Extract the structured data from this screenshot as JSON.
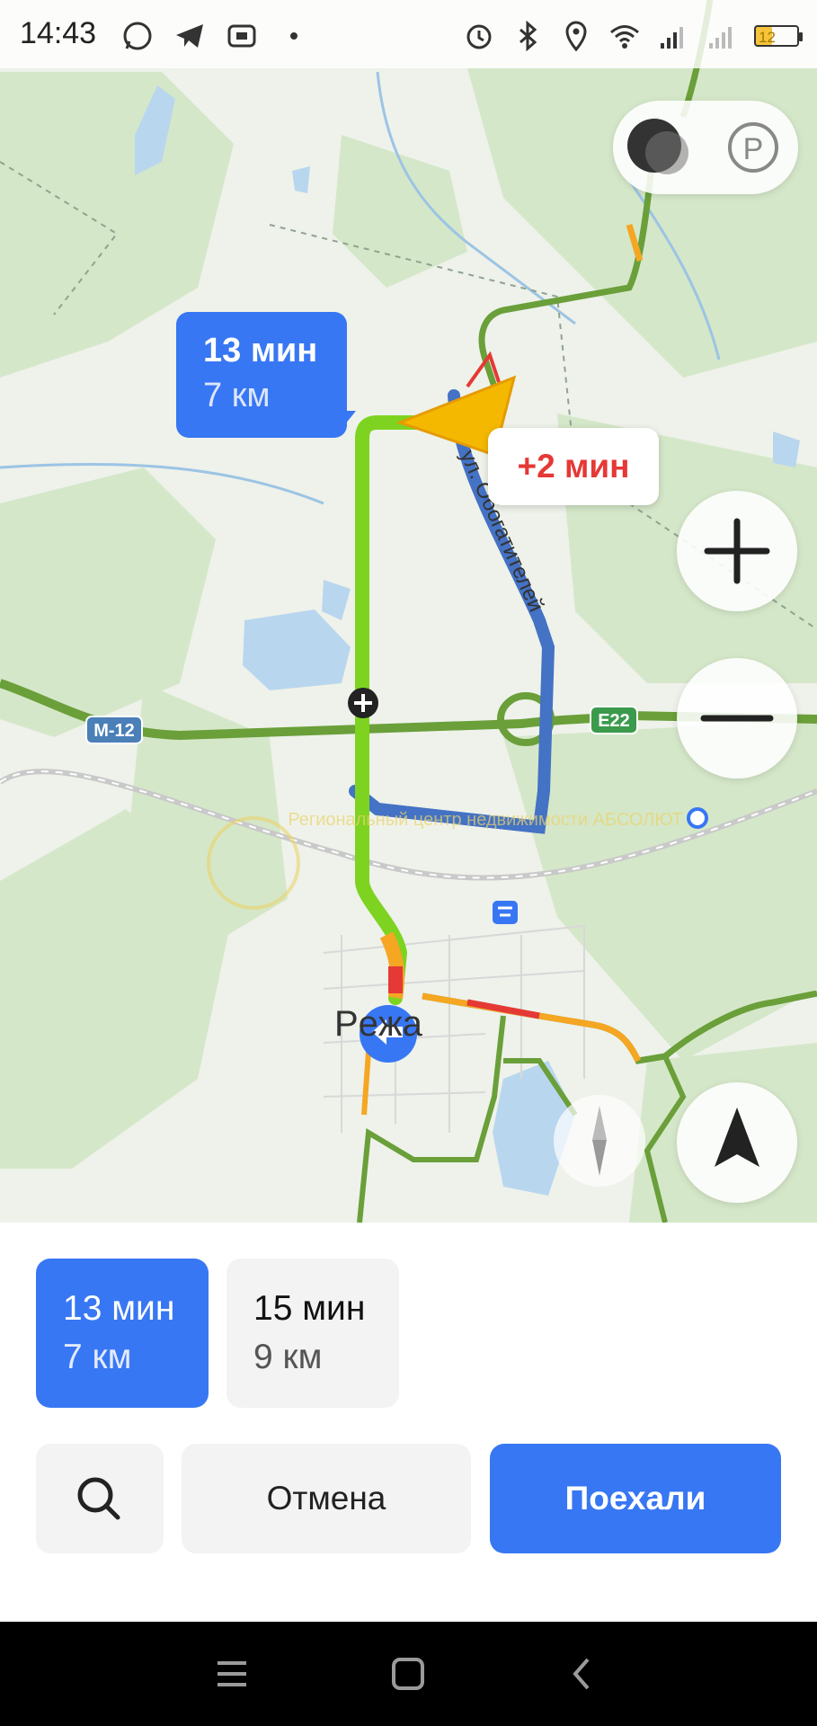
{
  "status_bar": {
    "time": "14:43",
    "left_icons": [
      "whatsapp-icon",
      "telegram-icon",
      "cast-icon",
      "dot-icon"
    ],
    "right_icons": [
      "alarm-icon",
      "bluetooth-icon",
      "location-icon",
      "wifi-icon",
      "signal-e-icon",
      "signal-g-icon"
    ],
    "battery_level": "12"
  },
  "map": {
    "road_labels": [
      "M-12",
      "E22",
      "ул. Обогатителей"
    ],
    "city_label": "Рeжa",
    "watermark": "Региональный центр недвижимости АБСОЛЮТ",
    "route_bubble": {
      "time": "13 мин",
      "distance": "7 км"
    },
    "alt_route_bubble": "+2 мин",
    "colors": {
      "route_fast": "#7ed321",
      "route_alt": "#4472c4",
      "traffic_slow": "#f5a623",
      "traffic_jam": "#e53935",
      "highway": "#6a9f3a",
      "accent": "#3877f3"
    },
    "controls": [
      "night-mode-icon",
      "parking-icon",
      "zoom-in-button",
      "zoom-out-button",
      "compass-icon",
      "locate-me-button"
    ]
  },
  "routes": [
    {
      "time": "13 мин",
      "distance": "7 км",
      "selected": true
    },
    {
      "time": "15 мин",
      "distance": "9 км",
      "selected": false
    }
  ],
  "actions": {
    "search_icon": "search-icon",
    "cancel_label": "Отмена",
    "go_label": "Поехали"
  },
  "nav_bar": [
    "menu-icon",
    "home-icon",
    "back-icon"
  ]
}
